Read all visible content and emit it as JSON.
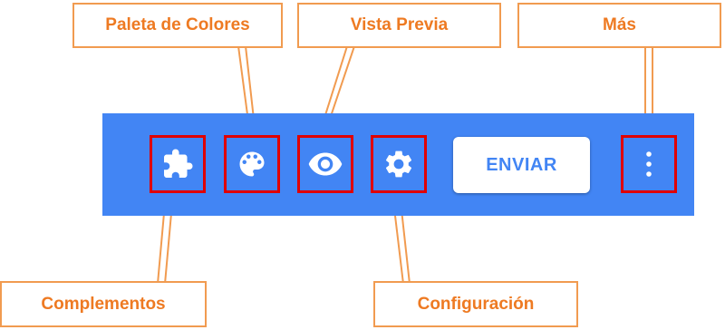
{
  "toolbar": {
    "background_color": "#4285f4",
    "send_button_label": "ENVIAR",
    "icons": {
      "addons": "puzzle-piece-icon",
      "palette": "palette-icon",
      "preview": "eye-icon",
      "settings": "gear-icon",
      "more": "vertical-ellipsis-icon"
    }
  },
  "callouts": {
    "palette": "Paleta de Colores",
    "preview": "Vista Previa",
    "more": "Más",
    "addons": "Complementos",
    "settings": "Configuración"
  },
  "colors": {
    "highlight_border": "#e00000",
    "callout_border": "#f19b50",
    "callout_text": "#ee7a22"
  }
}
